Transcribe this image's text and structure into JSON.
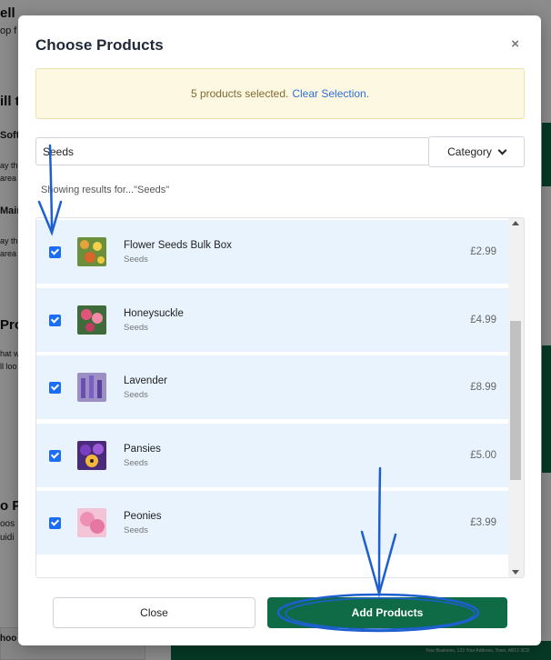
{
  "modal": {
    "title": "Choose Products",
    "close_icon": "×",
    "notice_text": "5 products selected.",
    "clear_selection": "Clear Selection.",
    "search_value": "Seeds",
    "category_label": "Category",
    "results_label": "Showing results for...\"Seeds\"",
    "products": [
      {
        "name": "Flower Seeds Bulk Box",
        "category": "Seeds",
        "price": "£2.99",
        "checked": true
      },
      {
        "name": "Honeysuckle",
        "category": "Seeds",
        "price": "£4.99",
        "checked": true
      },
      {
        "name": "Lavender",
        "category": "Seeds",
        "price": "£8.99",
        "checked": true
      },
      {
        "name": "Pansies",
        "category": "Seeds",
        "price": "£5.00",
        "checked": true
      },
      {
        "name": "Peonies",
        "category": "Seeds",
        "price": "£3.99",
        "checked": true
      }
    ],
    "close_button": "Close",
    "add_button": "Add Products"
  },
  "background": {
    "title_fragment": "ell",
    "sub_fragment": "op f",
    "h1": "ill t",
    "item1": "Soft",
    "item1_desc_a": "ay th",
    "item1_desc_b": "area",
    "item2": "Main",
    "item2_desc_a": "ay th",
    "item2_desc_b": "area",
    "h2": "Pro",
    "h2_desc_a": "hat w",
    "h2_desc_b": "ll loo",
    "h3": "o P",
    "h3_desc_a": "oos",
    "h3_desc_b": "uidi",
    "bottom_label": "hoo",
    "footer_text": "Your Business, 123 Your Address, Town, AB12 3CD"
  },
  "colors": {
    "accent_green": "#0e6b46",
    "checkbox_blue": "#1b6ef3",
    "row_highlight": "#e8f3fd",
    "annotation_blue": "#1e5fd0"
  }
}
